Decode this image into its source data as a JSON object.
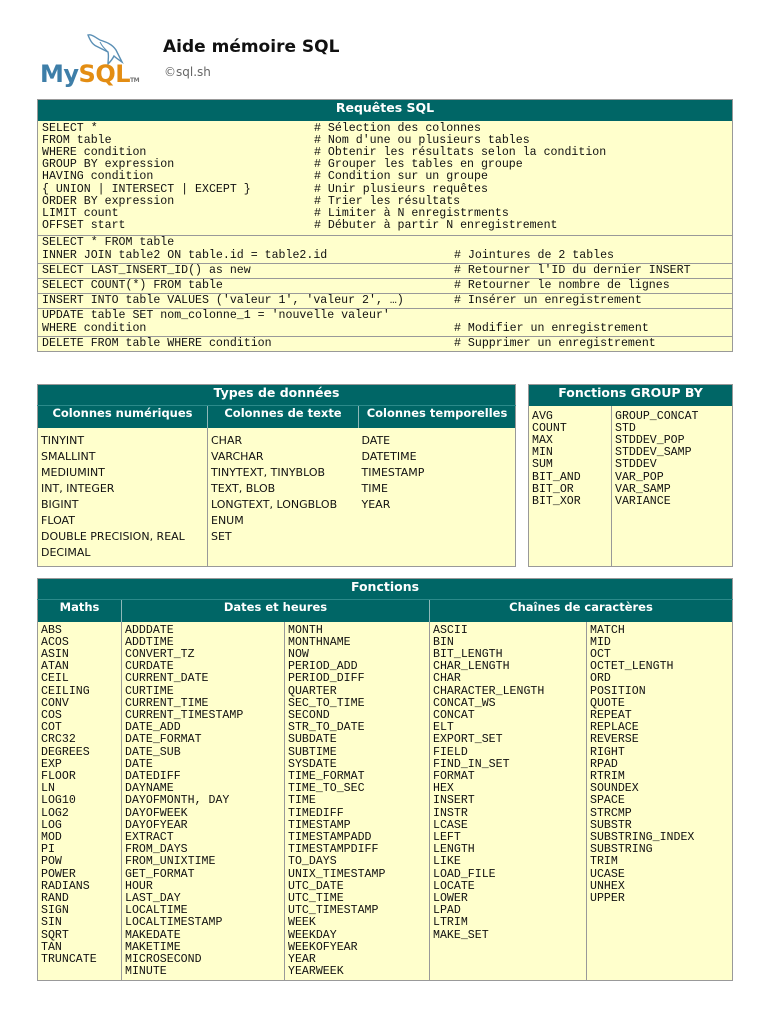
{
  "header": {
    "logo": {
      "my": "My",
      "sql": "SQL",
      "tm": "TM"
    },
    "title": "Aide mémoire SQL",
    "subtitle": "©sql.sh"
  },
  "requetes": {
    "title": "Requêtes SQL",
    "main_block": {
      "code": [
        "SELECT *",
        "FROM table",
        "WHERE condition",
        "GROUP BY expression",
        "HAVING condition",
        "{ UNION | INTERSECT | EXCEPT }",
        "ORDER BY expression",
        "LIMIT count",
        "OFFSET start"
      ],
      "comments": [
        "# Sélection des colonnes",
        "# Nom d'une ou plusieurs tables",
        "# Obtenir les résultats selon la condition",
        "# Grouper les tables en groupe",
        "# Condition sur un groupe",
        "# Unir plusieurs requêtes",
        "# Trier les résultats",
        "# Limiter à N enregistrments",
        "# Débuter à partir N enregistrement"
      ]
    },
    "rows": [
      {
        "code": [
          "SELECT * FROM table",
          "INNER JOIN table2 ON table.id = table2.id"
        ],
        "comment": "# Jointures de 2 tables"
      },
      {
        "code": [
          "SELECT LAST_INSERT_ID() as new"
        ],
        "comment": "# Retourner l'ID du dernier INSERT"
      },
      {
        "code": [
          "SELECT COUNT(*) FROM table"
        ],
        "comment": "# Retourner le nombre de lignes"
      },
      {
        "code": [
          "INSERT INTO table VALUES ('valeur 1', 'valeur 2', …)"
        ],
        "comment": "# Insérer un enregistrement"
      },
      {
        "code": [
          "UPDATE table SET nom_colonne_1 = 'nouvelle valeur'",
          "WHERE condition"
        ],
        "comment": "# Modifier un enregistrement"
      },
      {
        "code": [
          "DELETE FROM table WHERE condition"
        ],
        "comment": "# Supprimer un enregistrement"
      }
    ]
  },
  "types": {
    "title": "Types de données",
    "columns": [
      {
        "header": "Colonnes numériques",
        "items": [
          "TINYINT",
          "SMALLINT",
          "MEDIUMINT",
          "INT, INTEGER",
          "BIGINT",
          "FLOAT",
          "DOUBLE PRECISION, REAL",
          "DECIMAL"
        ]
      },
      {
        "header": "Colonnes de texte",
        "items": [
          "CHAR",
          "VARCHAR",
          "TINYTEXT, TINYBLOB",
          "TEXT, BLOB",
          "LONGTEXT, LONGBLOB",
          "ENUM",
          "SET"
        ]
      },
      {
        "header": "Colonnes temporelles",
        "items": [
          "DATE",
          "DATETIME",
          "TIMESTAMP",
          "TIME",
          "YEAR"
        ]
      }
    ]
  },
  "groupby": {
    "title": "Fonctions GROUP BY",
    "columns": [
      [
        "AVG",
        "COUNT",
        "MAX",
        "MIN",
        "SUM",
        "BIT_AND",
        "BIT_OR",
        "BIT_XOR"
      ],
      [
        "GROUP_CONCAT",
        "STD",
        "STDDEV_POP",
        "STDDEV_SAMP",
        "STDDEV",
        "VAR_POP",
        "VAR_SAMP",
        "VARIANCE"
      ]
    ]
  },
  "fonctions": {
    "title": "Fonctions",
    "maths": {
      "header": "Maths",
      "items": [
        "ABS",
        "ACOS",
        "ASIN",
        "ATAN",
        "CEIL",
        "CEILING",
        "CONV",
        "COS",
        "COT",
        "CRC32",
        "DEGREES",
        "EXP",
        "FLOOR",
        "LN",
        "LOG10",
        "LOG2",
        "LOG",
        "MOD",
        "PI",
        "POW",
        "POWER",
        "RADIANS",
        "RAND",
        "SIGN",
        "SIN",
        "SQRT",
        "TAN",
        "TRUNCATE"
      ]
    },
    "dates": {
      "header": "Dates et heures",
      "col1": [
        "ADDDATE",
        "ADDTIME",
        "CONVERT_TZ",
        "CURDATE",
        "CURRENT_DATE",
        "CURTIME",
        "CURRENT_TIME",
        "CURRENT_TIMESTAMP",
        "DATE_ADD",
        "DATE_FORMAT",
        "DATE_SUB",
        "DATE",
        "DATEDIFF",
        "DAYNAME",
        "DAYOFMONTH, DAY",
        "DAYOFWEEK",
        "DAYOFYEAR",
        "EXTRACT",
        "FROM_DAYS",
        "FROM_UNIXTIME",
        "GET_FORMAT",
        "HOUR",
        "LAST_DAY",
        "LOCALTIME",
        "LOCALTIMESTAMP",
        "MAKEDATE",
        "MAKETIME",
        "MICROSECOND",
        "MINUTE"
      ],
      "col2": [
        "MONTH",
        "MONTHNAME",
        "NOW",
        "PERIOD_ADD",
        "PERIOD_DIFF",
        "QUARTER",
        "SEC_TO_TIME",
        "SECOND",
        "STR_TO_DATE",
        "SUBDATE",
        "SUBTIME",
        "SYSDATE",
        "TIME_FORMAT",
        "TIME_TO_SEC",
        "TIME",
        "TIMEDIFF",
        "TIMESTAMP",
        "TIMESTAMPADD",
        "TIMESTAMPDIFF",
        "TO_DAYS",
        "UNIX_TIMESTAMP",
        "UTC_DATE",
        "UTC_TIME",
        "UTC_TIMESTAMP",
        "WEEK",
        "WEEKDAY",
        "WEEKOFYEAR",
        "YEAR",
        "YEARWEEK"
      ]
    },
    "chaines": {
      "header": "Chaînes de caractères",
      "col1": [
        "ASCII",
        "BIN",
        "BIT_LENGTH",
        "CHAR_LENGTH",
        "CHAR",
        "CHARACTER_LENGTH",
        "CONCAT_WS",
        "CONCAT",
        "ELT",
        "EXPORT_SET",
        "FIELD",
        "FIND_IN_SET",
        "FORMAT",
        "HEX",
        "INSERT",
        "INSTR",
        "LCASE",
        "LEFT",
        "LENGTH",
        "LIKE",
        "LOAD_FILE",
        "LOCATE",
        "LOWER",
        "LPAD",
        "LTRIM",
        "MAKE_SET"
      ],
      "col2": [
        "MATCH",
        "MID",
        "OCT",
        "OCTET_LENGTH",
        "ORD",
        "POSITION",
        "QUOTE",
        "REPEAT",
        "REPLACE",
        "REVERSE",
        "RIGHT",
        "RPAD",
        "RTRIM",
        "SOUNDEX",
        "SPACE",
        "STRCMP",
        "SUBSTR",
        "SUBSTRING_INDEX",
        "SUBSTRING",
        "TRIM",
        "UCASE",
        "UNHEX",
        "UPPER"
      ]
    }
  },
  "colors": {
    "header_bg": "#006666",
    "cell_bg": "#ffffcc",
    "mysql_blue": "#3e7ea8",
    "mysql_orange": "#e38d13"
  }
}
